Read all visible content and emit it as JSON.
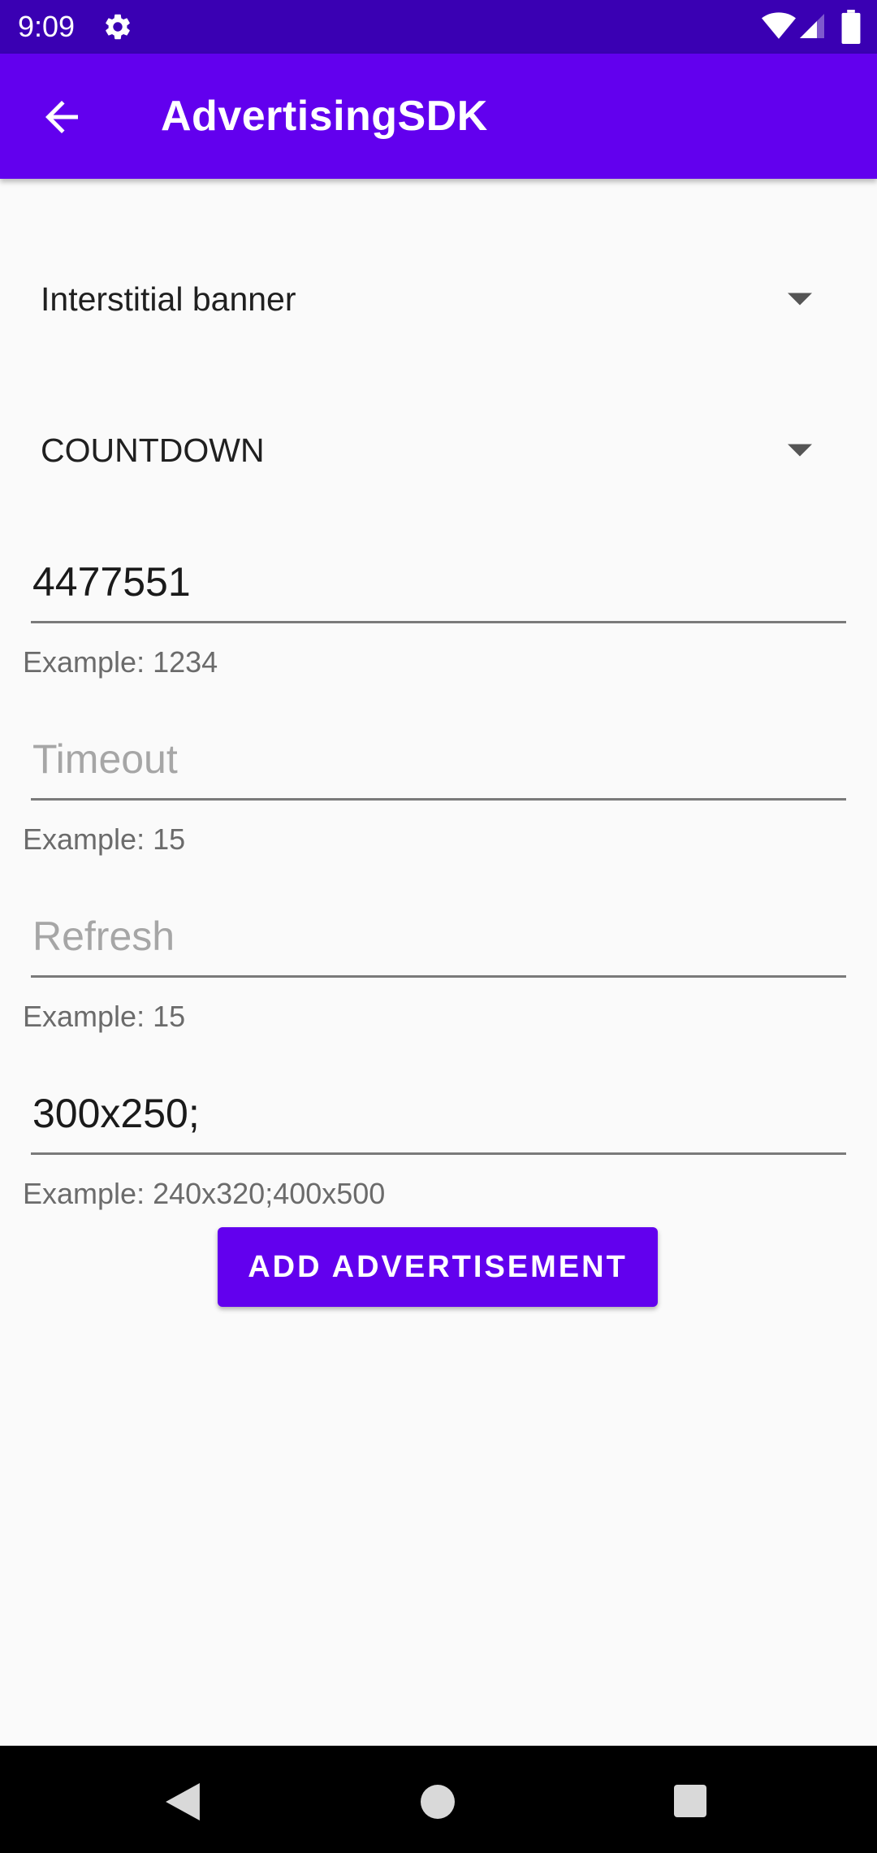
{
  "status_bar": {
    "time": "9:09",
    "icons": [
      "gear-icon",
      "wifi-icon",
      "signal-icon",
      "battery-icon"
    ]
  },
  "app_bar": {
    "title": "AdvertisingSDK",
    "back_icon": "arrow-back-icon"
  },
  "spinners": {
    "ad_type": "Interstitial banner",
    "close_mode": "COUNTDOWN"
  },
  "fields": {
    "zone_id": {
      "value": "4477551",
      "placeholder": "",
      "helper": "Example: 1234"
    },
    "timeout": {
      "value": "",
      "placeholder": "Timeout",
      "helper": "Example: 15"
    },
    "refresh": {
      "value": "",
      "placeholder": "Refresh",
      "helper": "Example: 15"
    },
    "sizes": {
      "value": "300x250;",
      "placeholder": "",
      "helper": "Example: 240x320;400x500"
    }
  },
  "actions": {
    "add_label": "ADD ADVERTISEMENT"
  },
  "nav_bar": {
    "icons": [
      "nav-back-icon",
      "nav-home-icon",
      "nav-recents-icon"
    ]
  },
  "colors": {
    "primary": "#6200ee",
    "status_bar": "#3a00b3",
    "background": "#fafafa"
  }
}
